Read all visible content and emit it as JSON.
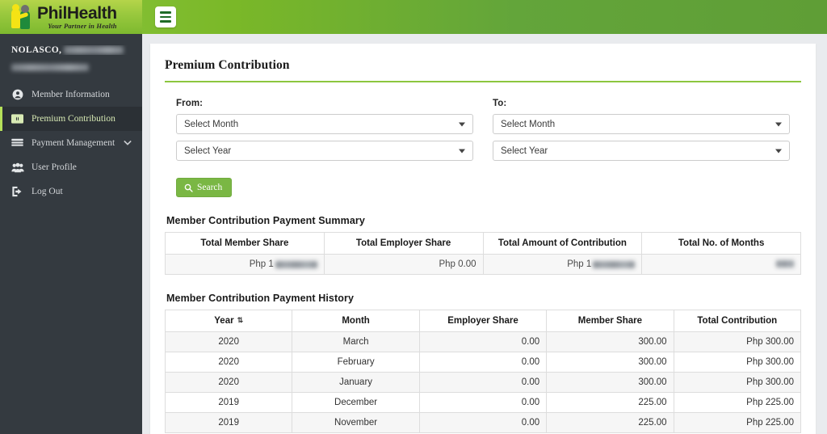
{
  "brand": {
    "name": "PhilHealth",
    "tagline": "Your Partner in Health",
    "accent_green": "#8dc63f",
    "header_green": "#7ab828",
    "sidebar_dark": "#343a40"
  },
  "topbar": {
    "menu_toggle": "menu-toggle"
  },
  "sidebar": {
    "user_name": "NOLASCO,",
    "user_name_redacted": true,
    "user_id_redacted": true,
    "items": [
      {
        "label": "Member Information",
        "icon": "user-circle-icon",
        "active": false,
        "has_chevron": false
      },
      {
        "label": "Premium Contribution",
        "icon": "banknote-icon",
        "active": true,
        "has_chevron": false
      },
      {
        "label": "Payment Management",
        "icon": "credit-card-icon",
        "active": false,
        "has_chevron": true
      },
      {
        "label": "User Profile",
        "icon": "users-icon",
        "active": false,
        "has_chevron": false
      },
      {
        "label": "Log Out",
        "icon": "logout-icon",
        "active": false,
        "has_chevron": false
      }
    ]
  },
  "page": {
    "title": "Premium Contribution"
  },
  "filters": {
    "from_label": "From:",
    "to_label": "To:",
    "from_month": "Select Month",
    "from_year": "Select Year",
    "to_month": "Select Month",
    "to_year": "Select Year",
    "search_label": "Search",
    "search_icon": "search-icon"
  },
  "summary": {
    "heading": "Member Contribution Payment Summary",
    "columns": [
      "Total Member Share",
      "Total Employer Share",
      "Total Amount of Contribution",
      "Total No. of Months"
    ],
    "values": {
      "total_member_share_prefix": "Php 1",
      "total_member_share_redacted": true,
      "total_employer_share": "Php 0.00",
      "total_amount_prefix": "Php 1",
      "total_amount_redacted": true,
      "total_months_redacted": true
    }
  },
  "history": {
    "heading": "Member Contribution Payment History",
    "columns": [
      "Year",
      "Month",
      "Employer Share",
      "Member Share",
      "Total Contribution"
    ],
    "sort_column": "Year",
    "sort_icon": "sort-updown-icon",
    "rows": [
      {
        "year": "2020",
        "month": "March",
        "employer_share": "0.00",
        "member_share": "300.00",
        "total": "Php 300.00"
      },
      {
        "year": "2020",
        "month": "February",
        "employer_share": "0.00",
        "member_share": "300.00",
        "total": "Php 300.00"
      },
      {
        "year": "2020",
        "month": "January",
        "employer_share": "0.00",
        "member_share": "300.00",
        "total": "Php 300.00"
      },
      {
        "year": "2019",
        "month": "December",
        "employer_share": "0.00",
        "member_share": "225.00",
        "total": "Php 225.00"
      },
      {
        "year": "2019",
        "month": "November",
        "employer_share": "0.00",
        "member_share": "225.00",
        "total": "Php 225.00"
      }
    ]
  }
}
